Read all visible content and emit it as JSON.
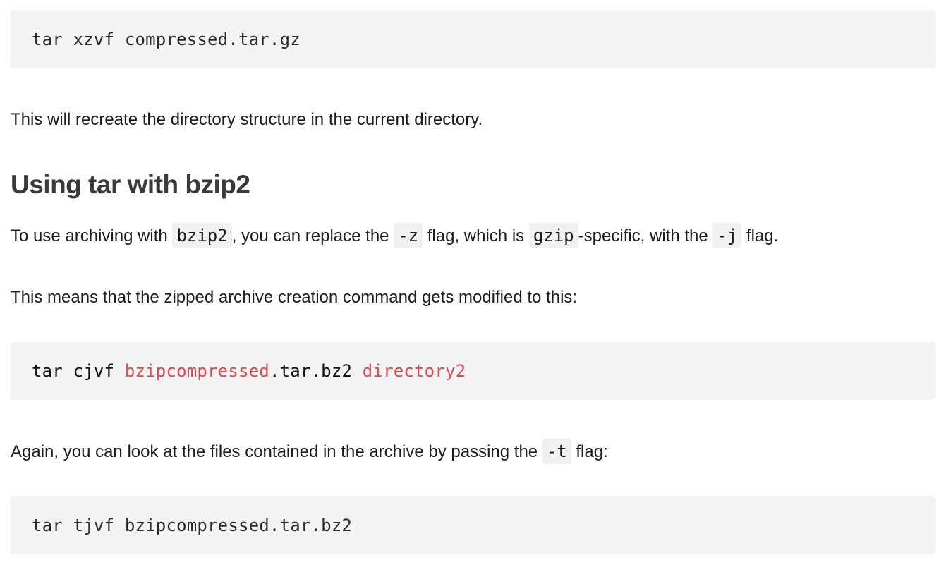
{
  "blocks": {
    "code1": "tar xzvf compressed.tar.gz",
    "para1": "This will recreate the directory structure in the current directory.",
    "heading": "Using tar with bzip2",
    "para2": {
      "t1": "To use archiving with ",
      "c1": "bzip2",
      "t2": ", you can replace the ",
      "c2": "-z",
      "t3": " flag, which is ",
      "c3": "gzip",
      "t4": "-specific, with the ",
      "c4": "-j",
      "t5": " flag."
    },
    "para3": "This means that the zipped archive creation command gets modified to this:",
    "code2": {
      "cmd": "tar cjvf ",
      "name": "bzipcompressed",
      "ext": ".tar.bz2 ",
      "dir": "directory2"
    },
    "para4": {
      "t1": "Again, you can look at the files contained in the archive by passing the ",
      "c1": "-t",
      "t2": " flag:"
    },
    "code3": "tar tjvf bzipcompressed.tar.bz2"
  },
  "colors": {
    "code_bg": "#f3f3f3",
    "code_highlight": "#e0474c",
    "heading": "#3a3a3a"
  }
}
